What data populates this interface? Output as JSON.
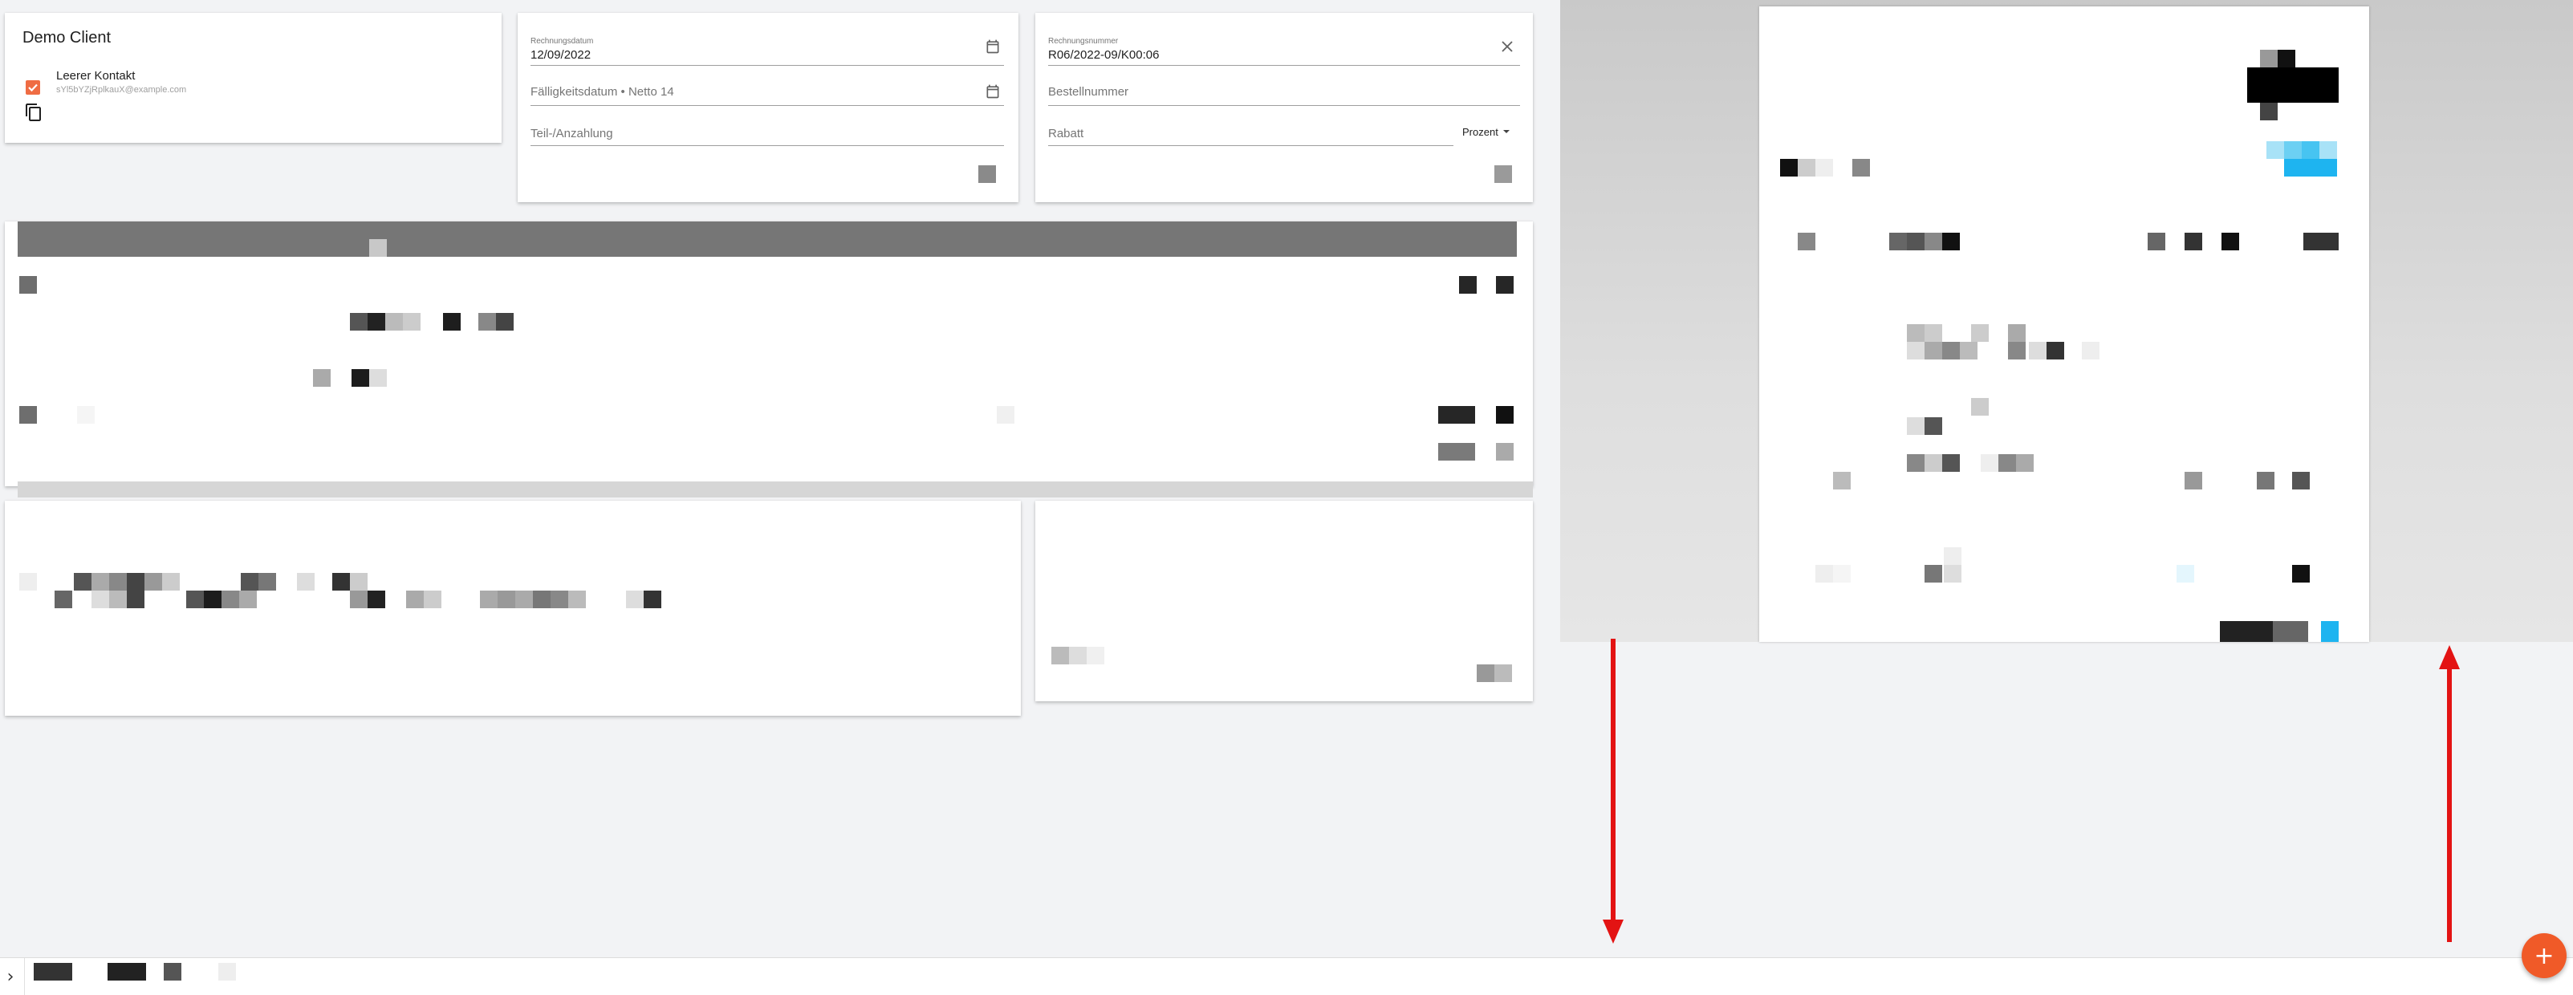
{
  "client": {
    "title": "Demo Client",
    "contact_name": "Leerer Kontakt",
    "contact_email": "sYl5bYZjRplkauX@example.com"
  },
  "invoice": {
    "date_label": "Rechnungsdatum",
    "date_value": "12/09/2022",
    "due_placeholder": "Fälligkeitsdatum • Netto 14",
    "partial_placeholder": "Teil-/Anzahlung",
    "number_label": "Rechnungsnummer",
    "number_value": "R06/2022-09/K00:06",
    "order_placeholder": "Bestellnummer",
    "discount_placeholder": "Rabatt",
    "discount_type": "Prozent"
  },
  "icons": {
    "copy": "copy-icon",
    "calendar": "calendar-icon",
    "clear": "close-icon",
    "dropdown": "chevron-down-icon",
    "expand": "chevron-right-icon",
    "add": "plus-icon"
  },
  "fab": {
    "label": "+"
  },
  "bottom": {
    "expand_label": "›"
  },
  "colors": {
    "accent": "#ef6c43",
    "fab": "#f05a28",
    "arrow": "#e31313",
    "table_header": "#767676",
    "preview_blue": "#1eb4f0"
  }
}
